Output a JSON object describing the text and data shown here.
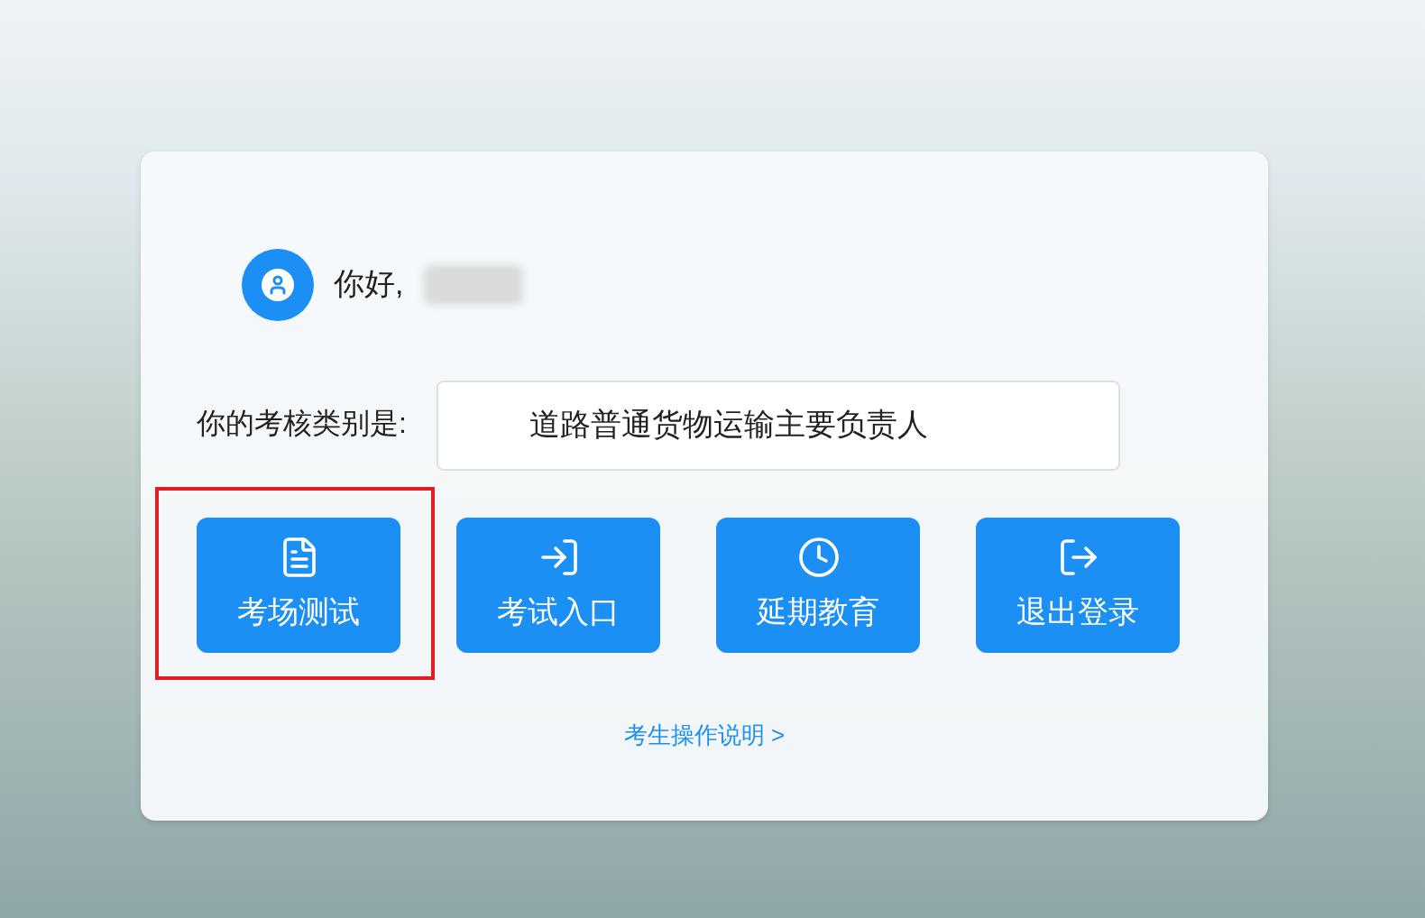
{
  "greeting": {
    "text": "你好,"
  },
  "category": {
    "label": "你的考核类别是:",
    "value": "道路普通货物运输主要负责人"
  },
  "buttons": [
    {
      "label": "考场测试",
      "kind": "document",
      "selected": true
    },
    {
      "label": "考试入口",
      "kind": "enter",
      "selected": false
    },
    {
      "label": "延期教育",
      "kind": "clock",
      "selected": false
    },
    {
      "label": "退出登录",
      "kind": "exit",
      "selected": false
    }
  ],
  "help_link": "考生操作说明 >"
}
